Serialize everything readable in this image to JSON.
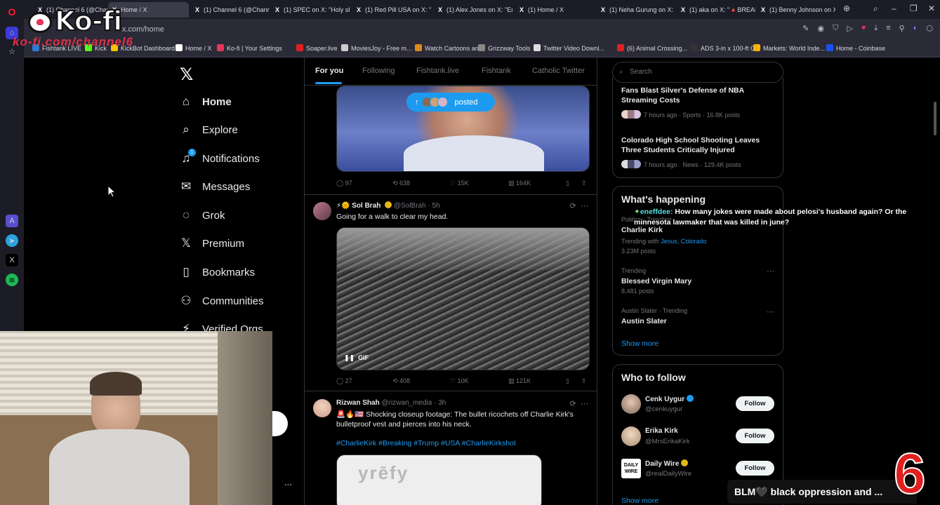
{
  "overlay": {
    "kofi_logo": "Ko-fi",
    "kofi_url": "ko-fi.com/channel6",
    "chat_user": "eneffdee:",
    "chat_message": "How many jokes were made about pelosi's husband again? Or the minnesota lawmaker that was killed in june?",
    "ticker": "BLM🖤 black oppression and ...",
    "channel_number": "6"
  },
  "browser": {
    "tabs": [
      {
        "label": "(1) Channel 6 (@Channel6..."
      },
      {
        "label": "Home / X"
      },
      {
        "label": "(1) Channel 6 (@Channel6"
      },
      {
        "label": "(1) SPEC on X: \"Holy shit t"
      },
      {
        "label": "(1) Red Pill USA on X: \"Ch"
      },
      {
        "label": "(1) Alex Jones on X: \"Eme"
      },
      {
        "label": "(1) Home / X"
      },
      {
        "label": "(1) Neha Gurung on X: \"B"
      },
      {
        "label": "(1) aka on X: \"🔺BREAKIN"
      },
      {
        "label": "(1) Benny Johnson on X: \""
      }
    ],
    "address": "x.com/home",
    "bookmarks": [
      {
        "label": "Fishtank LIVE",
        "color": "#2e7bd6"
      },
      {
        "label": "Kick",
        "color": "#53fc18"
      },
      {
        "label": "KickBot Dashboard",
        "color": "#f5c400"
      },
      {
        "label": "Home / X",
        "color": "#ffffff"
      },
      {
        "label": "Ko-fi | Your Settings",
        "color": "#e7355a"
      },
      {
        "label": "Soaper.live",
        "color": "#e02020"
      },
      {
        "label": "MoviesJoy - Free m...",
        "color": "#cccccc"
      },
      {
        "label": "Watch Cartoons an...",
        "color": "#d98a1a"
      },
      {
        "label": "Grizzway Tools",
        "color": "#888888"
      },
      {
        "label": "Twitter Video Downl...",
        "color": "#dddddd"
      },
      {
        "label": "(6) Animal Crossing...",
        "color": "#e02020"
      },
      {
        "label": "ADS 3-in x 100-ft C...",
        "color": "#333333"
      },
      {
        "label": "Markets: World Inde...",
        "color": "#f5b400"
      },
      {
        "label": "Home - Coinbase",
        "color": "#1652f0"
      }
    ]
  },
  "nav": {
    "items": [
      {
        "label": "Home",
        "icon": "home-icon",
        "glyph": "⌂"
      },
      {
        "label": "Explore",
        "icon": "search-icon",
        "glyph": "⌕"
      },
      {
        "label": "Notifications",
        "icon": "bell-icon",
        "glyph": "♫",
        "badge": "1"
      },
      {
        "label": "Messages",
        "icon": "mail-icon",
        "glyph": "✉"
      },
      {
        "label": "Grok",
        "icon": "grok-icon",
        "glyph": "◌"
      },
      {
        "label": "Premium",
        "icon": "x-icon",
        "glyph": "𝕏"
      },
      {
        "label": "Bookmarks",
        "icon": "bookmark-icon",
        "glyph": "▯"
      },
      {
        "label": "Communities",
        "icon": "people-icon",
        "glyph": "⚇"
      },
      {
        "label": "Verified Orgs",
        "icon": "lightning-icon",
        "glyph": "⚡"
      }
    ],
    "more_label": "..."
  },
  "feed": {
    "tabs": [
      "For you",
      "Following",
      "Fishtank.live",
      "Fishtank",
      "Catholic Twitter"
    ],
    "posted_label": "posted",
    "post1": {
      "replies": "97",
      "reposts": "638",
      "likes": "15K",
      "views": "164K"
    },
    "post2": {
      "name": "⚡🌞 Sol Brah",
      "handle": "@SolBrah · 5h",
      "text": "Going for a walk to clear my head.",
      "gif_label": "GIF",
      "replies": "27",
      "reposts": "408",
      "likes": "10K",
      "views": "121K"
    },
    "post3": {
      "name": "Rizwan Shah",
      "handle": "@rizwan_media · 3h",
      "text": "🚨🔥🇺🇸 Shocking closeup footage: The bullet ricochets off Charlie Kirk's bulletproof vest and pierces into his neck.",
      "hashtags": "#CharlieKirk #Breaking #Trump #USA #CharlieKirkshot",
      "media_text": "yrēfy"
    }
  },
  "sidebar": {
    "search_placeholder": "Search",
    "top_trends": [
      {
        "title": "Fans Blast Silver's Defense of NBA Streaming Costs",
        "meta": "7 hours ago · Sports · 16.8K posts"
      },
      {
        "title": "Colorado High School Shooting Leaves Three Students Critically Injured",
        "meta": "7 hours ago · News · 129.4K posts"
      }
    ],
    "happening": {
      "title": "What's happening",
      "trends": [
        {
          "meta": "Politics · Trending",
          "name": "Charlie Kirk",
          "with_label": "Trending with",
          "with": "Jesus, Colorado",
          "posts": "3.23M posts"
        },
        {
          "meta": "Trending",
          "name": "Blessed Virgin Mary",
          "posts": "8,481 posts"
        },
        {
          "meta": "Austin Slater · Trending",
          "name": "Austin Slater",
          "posts": ""
        }
      ],
      "show_more": "Show more"
    },
    "who_to_follow": {
      "title": "Who to follow",
      "accounts": [
        {
          "name": "Cenk Uygur",
          "handle": "@cenkuygur",
          "verified": "blue"
        },
        {
          "name": "Erika Kirk",
          "handle": "@MrsErikaKirk",
          "verified": ""
        },
        {
          "name": "Daily Wire",
          "handle": "@realDailyWire",
          "verified": "gold"
        }
      ],
      "follow_label": "Follow",
      "show_more": "Show more"
    }
  }
}
